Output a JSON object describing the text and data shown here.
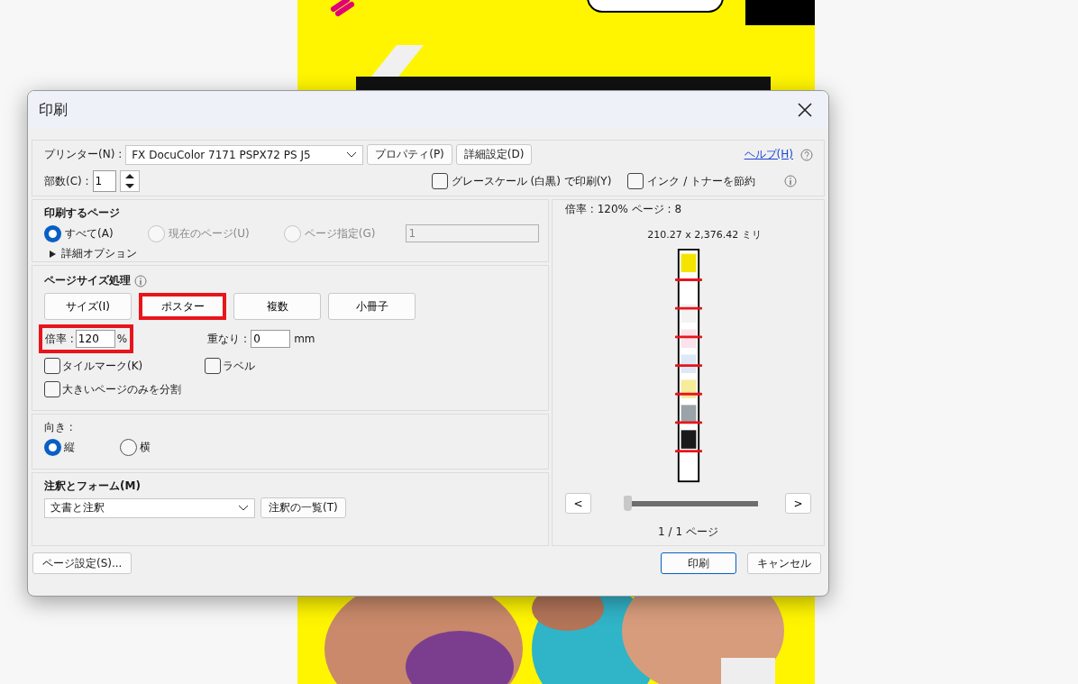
{
  "dialog": {
    "title": "印刷"
  },
  "printer": {
    "label": "プリンター(N) :",
    "value": "FX DocuColor 7171 PSPX72 PS J5",
    "buttons": [
      "プロパティ(P)",
      "詳細設定(D)"
    ]
  },
  "help": "ヘルプ(H)",
  "copies": {
    "label": "部数(C) :",
    "value": "1"
  },
  "options": [
    {
      "label": "グレースケール (白黒) で印刷(Y)",
      "checked": false
    },
    {
      "label": "インク / トナーを節約",
      "checked": false
    }
  ],
  "pages": {
    "title": "印刷するページ",
    "choices": [
      {
        "label": "すべて(A)",
        "selected": true,
        "disabled": false
      },
      {
        "label": "現在のページ(U)",
        "selected": false,
        "disabled": true
      },
      {
        "label": "ページ指定(G)",
        "selected": false,
        "disabled": true
      }
    ],
    "range": "1",
    "more": "詳細オプション"
  },
  "sizing": {
    "title": "ページサイズ処理",
    "modes": [
      {
        "label": "サイズ(I)",
        "selected": false
      },
      {
        "label": "ポスター",
        "selected": true
      },
      {
        "label": "複数",
        "selected": false
      },
      {
        "label": "小冊子",
        "selected": false
      }
    ],
    "scale_label": "倍率 :",
    "scale": "120",
    "scale_unit": "%",
    "scale_highlighted": true,
    "overlap_label": "重なり :",
    "overlap": "0",
    "overlap_unit": "mm",
    "checks": [
      {
        "label": "タイルマーク(K)",
        "checked": false
      },
      {
        "label": "ラベル",
        "checked": false
      },
      {
        "label": "大きいページのみを分割",
        "checked": false
      }
    ]
  },
  "orientation": {
    "title": "向き :",
    "choices": [
      {
        "label": "縦",
        "selected": true
      },
      {
        "label": "横",
        "selected": false
      }
    ]
  },
  "annotations": {
    "title": "注釈とフォーム(M)",
    "value": "文書と注釈",
    "button": "注釈の一覧(T)"
  },
  "preview": {
    "info": "倍率 : 120% ページ : 8",
    "size": "210.27 x 2,376.42 ミリ",
    "prev": "<",
    "next": ">",
    "level": 0,
    "page": "1 / 1 ページ"
  },
  "footer": {
    "page_setup": "ページ設定(S)...",
    "print": "印刷",
    "cancel": "キャンセル"
  }
}
